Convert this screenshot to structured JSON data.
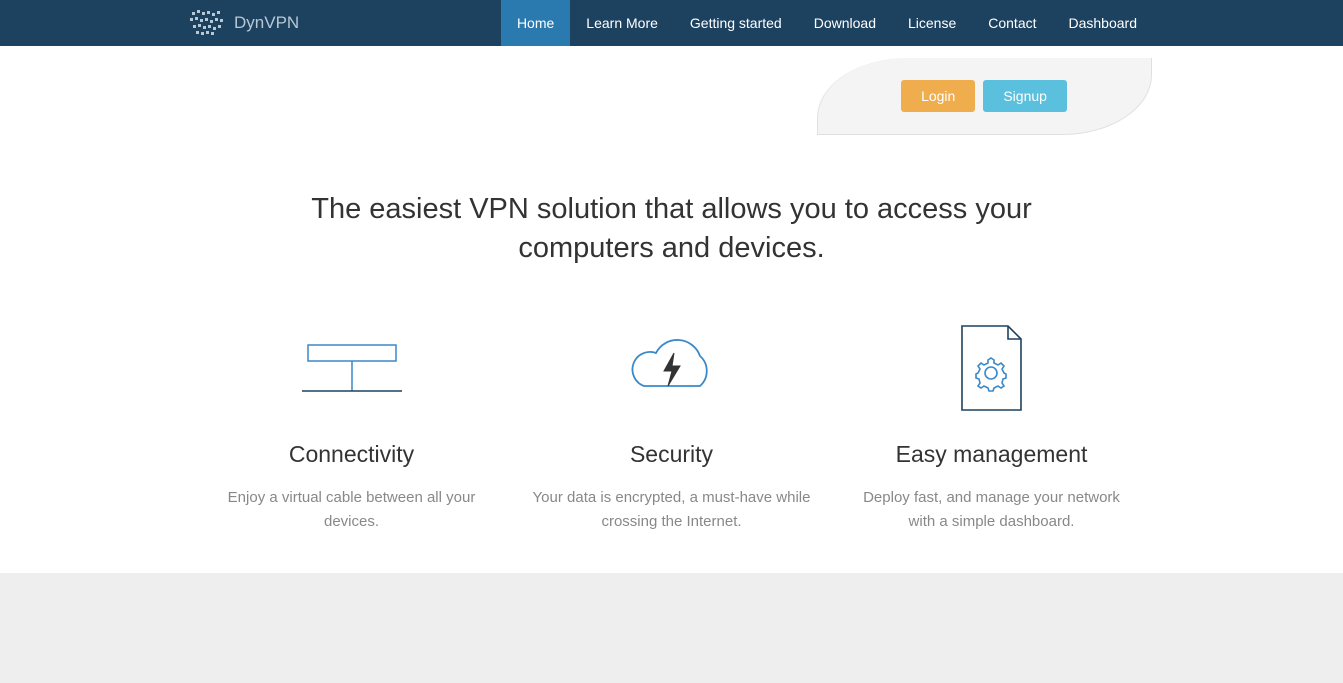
{
  "brand": {
    "name": "DynVPN"
  },
  "nav": {
    "items": [
      {
        "label": "Home",
        "active": true
      },
      {
        "label": "Learn More",
        "active": false
      },
      {
        "label": "Getting started",
        "active": false
      },
      {
        "label": "Download",
        "active": false
      },
      {
        "label": "License",
        "active": false
      },
      {
        "label": "Contact",
        "active": false
      },
      {
        "label": "Dashboard",
        "active": false
      }
    ]
  },
  "auth": {
    "login_label": "Login",
    "signup_label": "Signup"
  },
  "hero": {
    "headline": "The easiest VPN solution that allows you to access your computers and devices."
  },
  "features": [
    {
      "title": "Connectivity",
      "description": "Enjoy a virtual cable between all your devices."
    },
    {
      "title": "Security",
      "description": "Your data is encrypted, a must-have while crossing the Internet."
    },
    {
      "title": "Easy management",
      "description": "Deploy fast, and manage your network with a simple dashboard."
    }
  ],
  "colors": {
    "navbar": "#1d4260",
    "accent_active": "#2a7aaf",
    "btn_login": "#f0ad4e",
    "btn_signup": "#5bc0de",
    "icon_stroke": "#3a89c9"
  }
}
